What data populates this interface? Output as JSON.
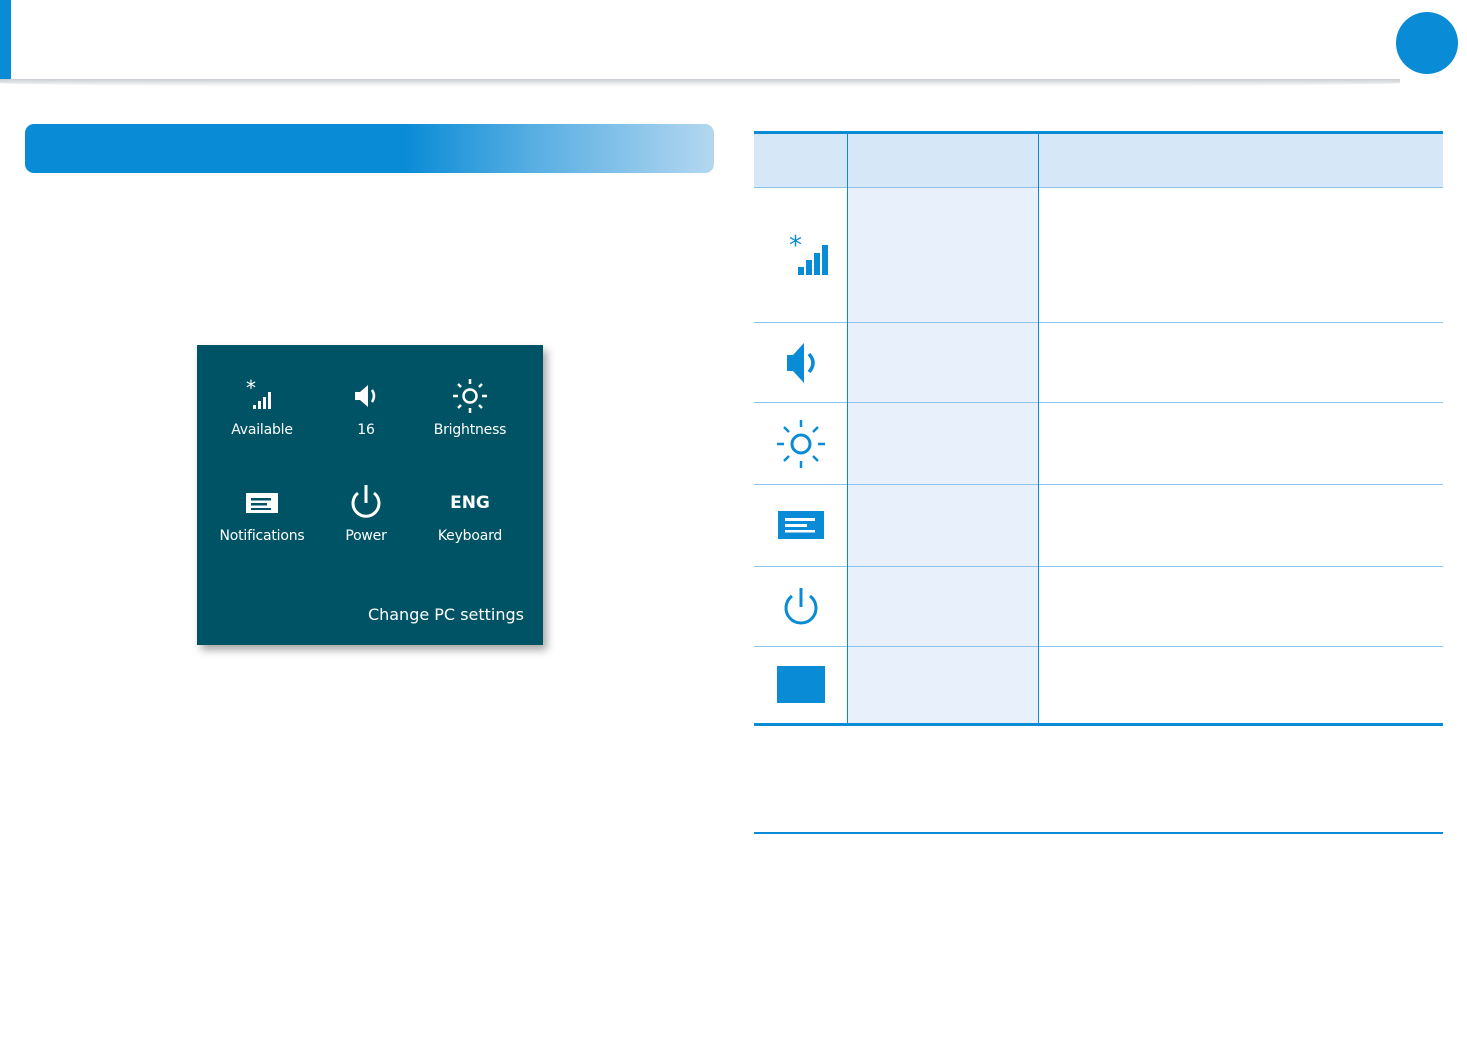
{
  "colors": {
    "accent": "#0a8bd6",
    "panel_bg": "#005364",
    "table_header_bg": "#d6e8f7",
    "table_col_bg": "#e8f1fb"
  },
  "settings_panel": {
    "tiles": [
      {
        "label": "Available",
        "icon": "network-signal-icon"
      },
      {
        "label": "16",
        "icon": "volume-icon"
      },
      {
        "label": "Brightness",
        "icon": "brightness-icon"
      },
      {
        "label": "Notifications",
        "icon": "notifications-icon"
      },
      {
        "label": "Power",
        "icon": "power-icon"
      },
      {
        "label": "Keyboard",
        "icon_text": "ENG"
      }
    ],
    "change_pc_settings": "Change PC settings"
  },
  "icon_table": {
    "rows": [
      {
        "icon": "network-signal-icon"
      },
      {
        "icon": "volume-icon"
      },
      {
        "icon": "brightness-icon"
      },
      {
        "icon": "notifications-icon"
      },
      {
        "icon": "power-icon"
      },
      {
        "icon": "keyboard-icon"
      }
    ]
  }
}
